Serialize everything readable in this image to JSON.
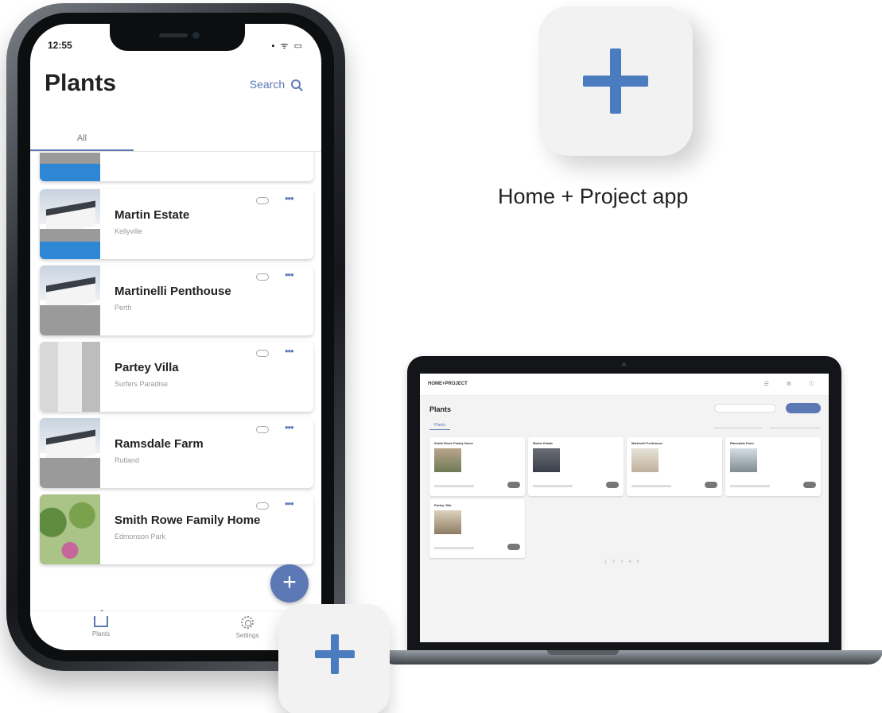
{
  "phone": {
    "status_time": "12:55",
    "status_icons": "▪ ᯤ ▭",
    "title": "Plants",
    "search_label": "Search",
    "tab_all": "All",
    "cards": [
      {
        "title": "",
        "subtitle": "",
        "thumb": "pool"
      },
      {
        "title": "Martin Estate",
        "subtitle": "Kellyville",
        "thumb": "pool"
      },
      {
        "title": "Martinelli Penthouse",
        "subtitle": "Perth",
        "thumb": "house"
      },
      {
        "title": "Partey Villa",
        "subtitle": "Surfers Paradise",
        "thumb": "interior"
      },
      {
        "title": "Ramsdale Farm",
        "subtitle": "Rutland",
        "thumb": "house"
      },
      {
        "title": "Smith Rowe Family Home",
        "subtitle": "Edmonson Park",
        "thumb": "trees"
      }
    ],
    "more_label": "•••",
    "fab_label": "+",
    "nav": {
      "plants": "Plants",
      "settings": "Settings"
    }
  },
  "app_caption": "Home + Project app",
  "laptop": {
    "logo": "HOME+PROJECT",
    "title": "Plants",
    "tab": "Plants",
    "cards": [
      {
        "title": "Smith Rowe Family Home"
      },
      {
        "title": "Martin Estate"
      },
      {
        "title": "Martinelli Penthouse"
      },
      {
        "title": "Ramsdale Farm"
      },
      {
        "title": "Partey Villa"
      }
    ],
    "pager": "1 2 3 4 5"
  },
  "colors": {
    "accent": "#5d79b5",
    "plus": "#4c7cc0",
    "icon_bg": "#f2f2f2"
  }
}
